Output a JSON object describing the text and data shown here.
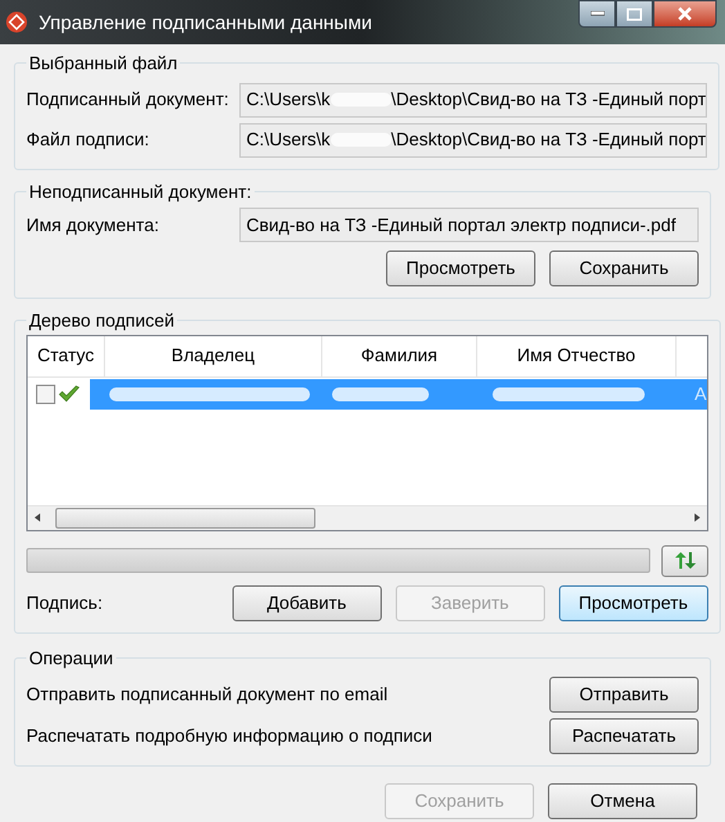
{
  "window": {
    "title": "Управление подписанными данными"
  },
  "selected_file": {
    "legend": "Выбранный файл",
    "fields": [
      {
        "label": "Подписанный документ:",
        "path_start": "C:\\Users\\k",
        "path_end": "\\Desktop\\Свид-во на ТЗ -Единый порт"
      },
      {
        "label": "Файл подписи:",
        "path_start": "C:\\Users\\k",
        "path_end": "\\Desktop\\Свид-во на ТЗ -Единый порт"
      }
    ]
  },
  "unsigned_document": {
    "legend": "Неподписанный документ:",
    "label": "Имя документа:",
    "value": "Свид-во на ТЗ -Единый портал электр подписи-.pdf",
    "buttons": [
      {
        "label": "Просмотреть",
        "disabled": false
      },
      {
        "label": "Сохранить",
        "disabled": false
      }
    ]
  },
  "signature_tree": {
    "legend": "Дерево подписей",
    "columns": [
      "Статус",
      "Владелец",
      "Фамилия",
      "Имя Отчество"
    ],
    "rows": [
      {
        "selected": true,
        "checked": false,
        "verified": true,
        "column_5": "А"
      }
    ],
    "progress": {
      "level": 0
    },
    "label": "Подпись:",
    "buttons": [
      {
        "label": "Добавить",
        "disabled": false,
        "focused": false
      },
      {
        "label": "Заверить",
        "disabled": true,
        "focused": false
      },
      {
        "label": "Просмотреть",
        "disabled": false,
        "focused": true
      }
    ]
  },
  "operations": {
    "legend": "Операции",
    "items": [
      {
        "text": "Отправить подписанный документ по email",
        "button": "Отправить"
      },
      {
        "text": "Распечатать подробную информацию о подписи",
        "button": "Распечатать"
      }
    ]
  },
  "footer_buttons": [
    {
      "label": "Сохранить",
      "disabled": true
    },
    {
      "label": "Отмена",
      "disabled": false
    }
  ]
}
